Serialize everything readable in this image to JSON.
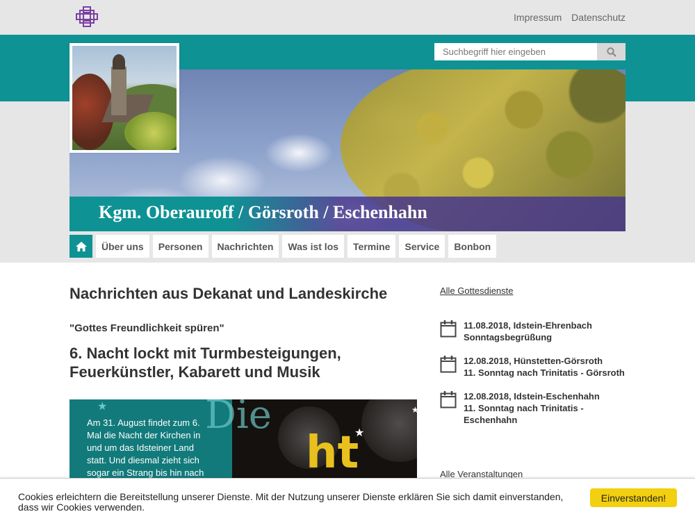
{
  "header": {
    "links": [
      "Impressum",
      "Datenschutz"
    ]
  },
  "search": {
    "placeholder": "Suchbegriff hier eingeben"
  },
  "hero": {
    "title": "Kgm. Oberauroff / Görsroth / Eschenhahn"
  },
  "nav": {
    "items": [
      "Über uns",
      "Personen",
      "Nachrichten",
      "Was ist los",
      "Termine",
      "Service",
      "Bonbon"
    ]
  },
  "main": {
    "heading": "Nachrichten aus Dekanat und Landeskirche",
    "quote": "\"Gottes Freundlichkeit spüren\"",
    "article_title": "6. Nacht lockt mit Turmbesteigungen, Feuerkünstler, Kabarett und Musik",
    "article_teaser": "Am 31. August findet zum 6. Mal die Nacht der Kirchen in und um das Idsteiner Land statt. Und diesmal zieht sich sogar ein Strang bis hin nach"
  },
  "sidebar": {
    "all_services": "Alle Gottesdienste",
    "events": [
      {
        "line1": "11.08.2018, Idstein-Ehrenbach",
        "line2": "Sonntagsbegrüßung"
      },
      {
        "line1": "12.08.2018, Hünstetten-Görsroth",
        "line2": "11. Sonntag nach Trinitatis - Görsroth"
      },
      {
        "line1": "12.08.2018, Idstein-Eschenhahn",
        "line2": "11. Sonntag nach Trinitatis - Eschenhahn"
      }
    ],
    "all_events": "Alle Veranstaltungen"
  },
  "cookie": {
    "message": "Cookies erleichtern die Bereitstellung unserer Dienste. Mit der Nutzung unserer Dienste erklären Sie sich damit einverstanden, dass wir Cookies verwenden.",
    "button": "Einverstanden!"
  },
  "colors": {
    "teal": "#0f9294",
    "purple_title_bar": "#46378c",
    "cookie_button": "#f2cf0f",
    "logo": "#7a3fa0"
  }
}
